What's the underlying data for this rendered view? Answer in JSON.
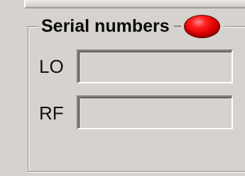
{
  "group": {
    "title": "Serial numbers",
    "status_icon": "red-led-indicator",
    "status_color": "#e00000"
  },
  "fields": [
    {
      "label": "LO",
      "value": ""
    },
    {
      "label": "RF",
      "value": ""
    }
  ]
}
